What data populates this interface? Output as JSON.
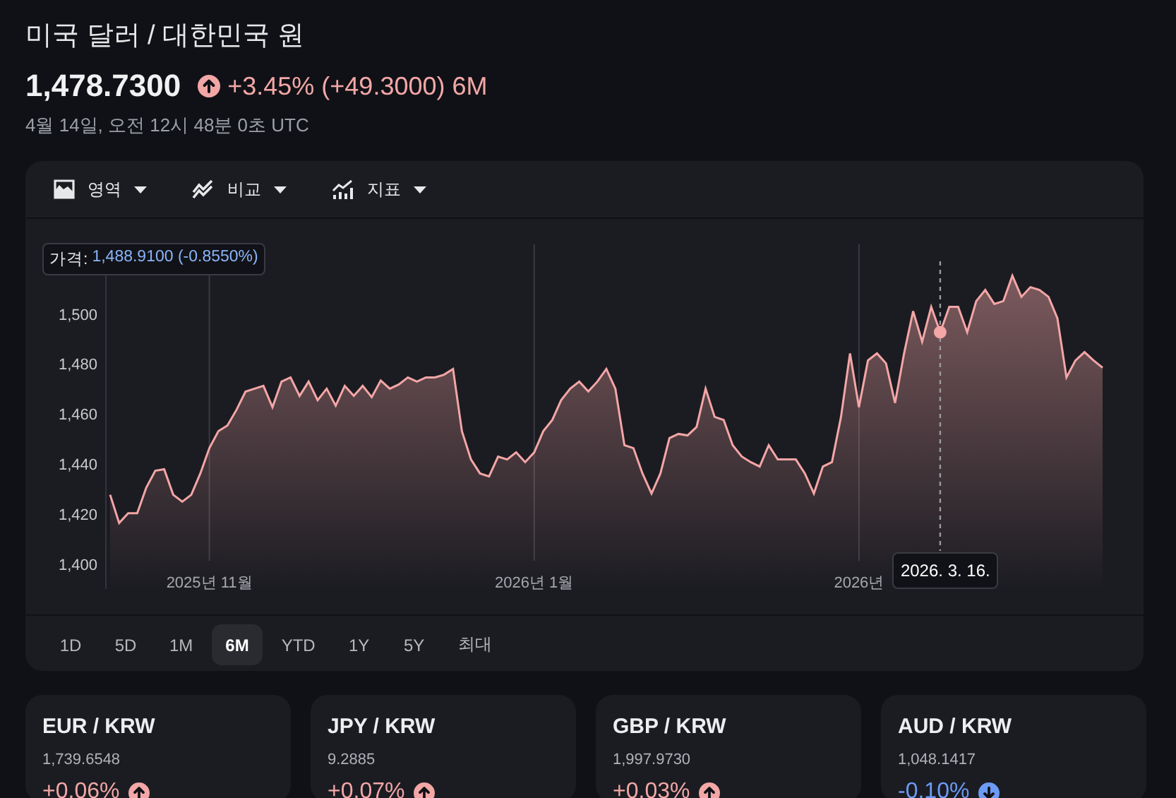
{
  "header": {
    "title": "미국 달러 / 대한민국 원",
    "price": "1,478.7300",
    "up": true,
    "change": "+3.45% (+49.3000) 6M",
    "timestamp": "4월 14일, 오전 12시 48분 0초 UTC"
  },
  "toolbar": [
    {
      "label": "영역"
    },
    {
      "label": "비교"
    },
    {
      "label": "지표"
    }
  ],
  "chart": {
    "hover": {
      "price_label": "가격:",
      "price_value": "1,488.9100 (-0.8550%)",
      "date": "2026. 3. 16."
    },
    "chart_data": {
      "type": "area",
      "grid": true,
      "ylim": [
        1390,
        1525
      ],
      "yticks": [
        {
          "value": 1400,
          "label": "1,400"
        },
        {
          "value": 1420,
          "label": "1,420"
        },
        {
          "value": 1440,
          "label": "1,440"
        },
        {
          "value": 1460,
          "label": "1,460"
        },
        {
          "value": 1480,
          "label": "1,480"
        },
        {
          "value": 1500,
          "label": "1,500"
        }
      ],
      "categories": [
        null,
        null,
        null,
        null,
        null,
        null,
        null,
        null,
        null,
        null,
        null,
        "2025년 11월",
        null,
        null,
        null,
        null,
        null,
        null,
        null,
        null,
        null,
        null,
        null,
        null,
        null,
        null,
        null,
        null,
        null,
        null,
        null,
        null,
        null,
        null,
        null,
        null,
        null,
        null,
        null,
        null,
        null,
        null,
        null,
        null,
        null,
        null,
        null,
        "2026년 1월",
        null,
        null,
        null,
        null,
        null,
        null,
        null,
        null,
        null,
        null,
        null,
        null,
        null,
        null,
        null,
        null,
        null,
        null,
        null,
        null,
        null,
        null,
        null,
        null,
        null,
        null,
        null,
        null,
        null,
        null,
        null,
        null,
        null,
        null,
        null,
        "2026년",
        null,
        null,
        null,
        null,
        null,
        null,
        null,
        null,
        null,
        null,
        null,
        null,
        null,
        null,
        null,
        null,
        null,
        null,
        null,
        null,
        null,
        null,
        null,
        null,
        null,
        null,
        null
      ],
      "series": [
        {
          "color": "#f4a6a6",
          "values": [
            1427.7,
            1416.4,
            1420.3,
            1420.3,
            1430.5,
            1437.3,
            1437.9,
            1427.7,
            1424.9,
            1427.7,
            1436.2,
            1446.3,
            1453.1,
            1455.4,
            1461.6,
            1468.9,
            1470.1,
            1471.2,
            1462.7,
            1472.9,
            1474.6,
            1467.2,
            1472.9,
            1465.5,
            1470.1,
            1463.3,
            1471.2,
            1467.2,
            1471.2,
            1466.7,
            1473.4,
            1470.1,
            1471.8,
            1474.6,
            1472.9,
            1474.6,
            1474.6,
            1475.7,
            1478,
            1453.1,
            1441.8,
            1436.2,
            1435,
            1442.9,
            1441.8,
            1444.6,
            1440.7,
            1444.6,
            1453.1,
            1457.6,
            1465.5,
            1470.1,
            1472.9,
            1469,
            1472.9,
            1478,
            1470.1,
            1447.5,
            1446.3,
            1436.2,
            1428.2,
            1436.2,
            1450.3,
            1452,
            1451.4,
            1454.8,
            1470.1,
            1458.8,
            1457.6,
            1447.5,
            1443,
            1440.7,
            1439,
            1447.5,
            1441.8,
            1441.8,
            1441.8,
            1436.2,
            1428.2,
            1439,
            1440.7,
            1458.8,
            1484.2,
            1462.7,
            1481.4,
            1484.2,
            1480.2,
            1464.4,
            1484.2,
            1501.1,
            1488.9,
            1502.8,
            1492.7,
            1502.8,
            1502.8,
            1492.7,
            1505.1,
            1509.6,
            1504,
            1505.1,
            1515.3,
            1506.8,
            1510.7,
            1509.6,
            1506.8,
            1498.3,
            1474.6,
            1481.4,
            1484.7,
            1481.4,
            1478.5
          ]
        }
      ]
    }
  },
  "ranges": [
    {
      "label": "1D",
      "selected": false
    },
    {
      "label": "5D",
      "selected": false
    },
    {
      "label": "1M",
      "selected": false
    },
    {
      "label": "6M",
      "selected": true
    },
    {
      "label": "YTD",
      "selected": false
    },
    {
      "label": "1Y",
      "selected": false
    },
    {
      "label": "5Y",
      "selected": false
    },
    {
      "label": "최대",
      "selected": false
    }
  ],
  "pairs": [
    {
      "name": "EUR / KRW",
      "value": "1,739.6548",
      "change": "+0.06%",
      "up": true
    },
    {
      "name": "JPY / KRW",
      "value": "9.2885",
      "change": "+0.07%",
      "up": true
    },
    {
      "name": "GBP / KRW",
      "value": "1,997.9730",
      "change": "+0.03%",
      "up": true
    },
    {
      "name": "AUD / KRW",
      "value": "1,048.1417",
      "change": "-0.10%",
      "up": false
    }
  ]
}
